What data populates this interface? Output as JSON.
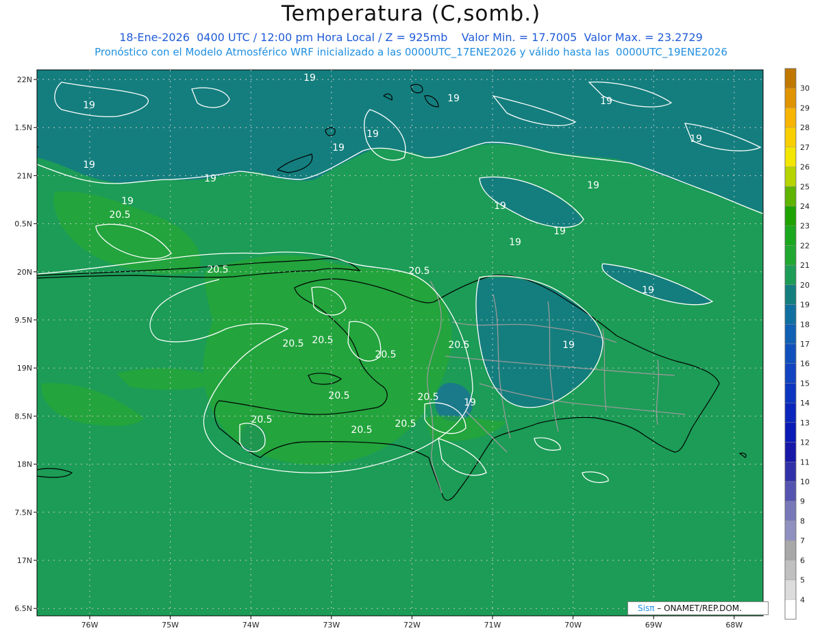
{
  "header": {
    "title": "Temperatura (C,somb.)",
    "line1": "18-Ene-2026  0400 UTC / 12:00 pm Hora Local / Z = 925mb    Valor Min. = 17.7005  Valor Max. = 23.2729",
    "line2": "Pronóstico con el Modelo Atmosférico WRF inicializado a las 0000UTC_17ENE2026 y válido hasta las  0000UTC_19ENE2026"
  },
  "axes": {
    "lat_labels": [
      "22N",
      "1.5N",
      "21N",
      "0.5N",
      "20N",
      "9.5N",
      "19N",
      "8.5N",
      "18N",
      "7.5N",
      "17N",
      "6.5N"
    ],
    "lon_labels": [
      "76W",
      "75W",
      "74W",
      "73W",
      "72W",
      "71W",
      "70W",
      "69W",
      "68W"
    ]
  },
  "colorbar": {
    "levels": [
      "30",
      "29",
      "28",
      "27",
      "26",
      "25",
      "24",
      "23",
      "22",
      "21",
      "20",
      "19",
      "18",
      "17",
      "16",
      "15",
      "14",
      "13",
      "12",
      "11",
      "10",
      "9",
      "8",
      "7",
      "6",
      "5",
      "4"
    ],
    "colors": [
      "#c07800",
      "#e09400",
      "#f7b400",
      "#f9cf00",
      "#f3e600",
      "#b6d400",
      "#5fb400",
      "#1ea200",
      "#1aa81e",
      "#20a830",
      "#1c9c56",
      "#147e7e",
      "#0f6fa0",
      "#1060b4",
      "#1050bc",
      "#1044c0",
      "#0c36c0",
      "#0a26bc",
      "#0a1ab6",
      "#1818a8",
      "#3030a8",
      "#5454b0",
      "#7878b8",
      "#9090c0",
      "#a8a8a8",
      "#c0c0c0",
      "#dcdcdc",
      "#ffffff"
    ]
  },
  "contour_labels": [
    "19",
    "19",
    "19",
    "19",
    "19",
    "19",
    "19",
    "19",
    "19",
    "19",
    "19",
    "19",
    "19",
    "19",
    "19",
    "19",
    "20.5",
    "20.5",
    "20.5",
    "20.5",
    "20.5",
    "20.5",
    "20.5",
    "20.5",
    "20.5",
    "20.5",
    "20.5",
    "20.5",
    "19"
  ],
  "credit": {
    "brand": "Sisπ",
    "text": "–  ONAMET/REP.DOM."
  },
  "colors": {
    "field": "#1c9c56",
    "cool": "#147e7e",
    "warm": "#2aac2a",
    "coast": "#000000",
    "borders": "#9a9a9a"
  }
}
